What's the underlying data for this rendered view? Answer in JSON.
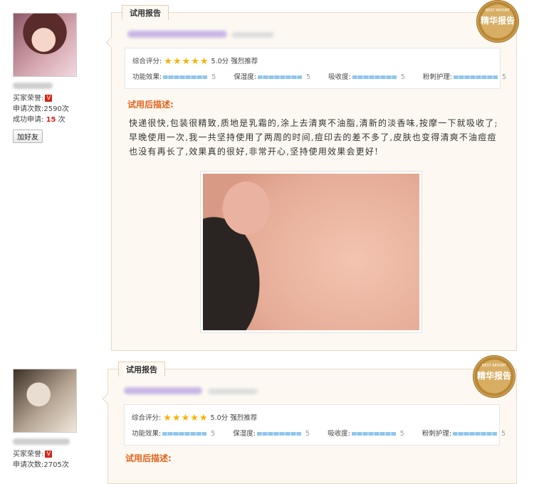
{
  "reports": [
    {
      "user": {
        "honor_label": "买家荣誉:",
        "honor_badge": "V",
        "apply_count_label": "申请次数:",
        "apply_count": "2590次",
        "success_label": "成功申请:",
        "success_count": "15",
        "success_unit": "次",
        "add_friend": "加好友"
      },
      "tab": "试用报告",
      "seal": {
        "top": "BEST REPORT",
        "main": "精华报告"
      },
      "scores": {
        "overall_label": "综合评分:",
        "stars": 5,
        "overall_value": "5.0分",
        "overall_text": "强烈推荐",
        "metrics": [
          {
            "label": "功能效果:",
            "value": "5",
            "level": 1.0
          },
          {
            "label": "保湿度:",
            "value": "5",
            "level": 1.0
          },
          {
            "label": "吸收度:",
            "value": "5",
            "level": 1.0
          },
          {
            "label": "粉刺护理:",
            "value": "5",
            "level": 1.0
          }
        ]
      },
      "desc_heading": "试用后描述:",
      "desc": "快递很快,包装很精致,质地是乳霜的,涂上去清爽不油脂,清新的淡香味,按摩一下就吸收了;早晚使用一次,我一共坚持使用了两周的时间,痘印去的差不多了,皮肤也变得清爽不油痘痘也没有再长了,效果真的很好,非常开心,坚持使用效果会更好!"
    },
    {
      "user": {
        "honor_label": "买家荣誉:",
        "honor_badge": "V",
        "apply_count_label": "申请次数:",
        "apply_count": "2705次"
      },
      "tab": "试用报告",
      "seal": {
        "top": "BEST REPORT",
        "main": "精华报告"
      },
      "scores": {
        "overall_label": "综合评分:",
        "stars": 5,
        "overall_value": "5.0分",
        "overall_text": "强烈推荐",
        "metrics": [
          {
            "label": "功能效果:",
            "value": "5",
            "level": 1.0
          },
          {
            "label": "保湿度:",
            "value": "5",
            "level": 1.0
          },
          {
            "label": "吸收度:",
            "value": "5",
            "level": 1.0
          },
          {
            "label": "粉刺护理:",
            "value": "5",
            "level": 1.0
          }
        ]
      },
      "desc_heading": "试用后描述:"
    }
  ],
  "colors": {
    "accent": "#e4631c",
    "star": "#f4b400",
    "card_bg": "#fdf9f2"
  }
}
